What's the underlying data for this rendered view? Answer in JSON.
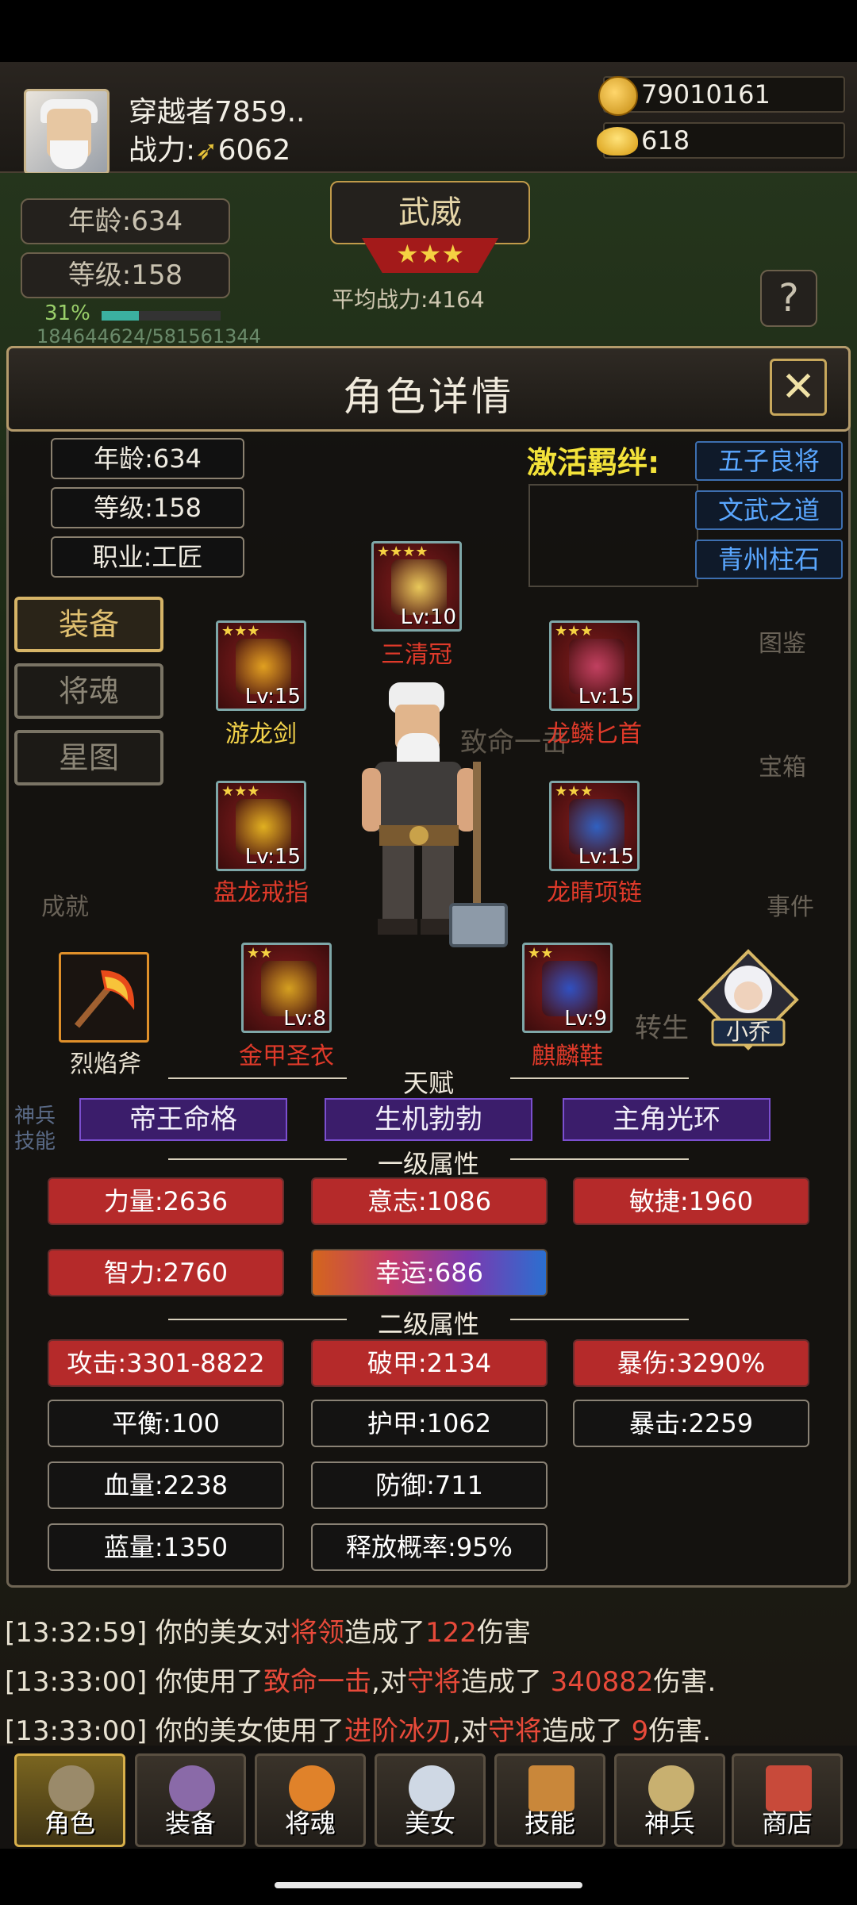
{
  "header": {
    "player_name": "穿越者7859..",
    "power_label": "战力:",
    "power_value": "6062",
    "gold": "79010161",
    "ingot": "618"
  },
  "background": {
    "age": "年龄:634",
    "level": "等级:158",
    "progress_pct": "31%",
    "exp": "184644624/581561344",
    "title_badge": "武威",
    "avg_power": "平均战力:4164",
    "help": "?",
    "side_labels": [
      "图鉴",
      "宝箱",
      "成就",
      "事件",
      "转生"
    ],
    "side_left": [
      "神兵",
      "技能"
    ],
    "center_text": "致命一击"
  },
  "panel": {
    "title": "角色详情",
    "close": "✕",
    "info": {
      "age": "年龄:634",
      "level": "等级:158",
      "job": "职业:工匠"
    },
    "bond_title": "激活羁绊:",
    "bonds": [
      "五子良将",
      "文武之道",
      "青州柱石"
    ],
    "tabs": [
      "装备",
      "将魂",
      "星图"
    ],
    "equipment": [
      {
        "name": "三清冠",
        "lv": "Lv:10",
        "stars": 4,
        "color": "#e8c85a"
      },
      {
        "name": "游龙剑",
        "lv": "Lv:15",
        "stars": 3,
        "color": "#e0a020"
      },
      {
        "name": "龙鳞匕首",
        "lv": "Lv:15",
        "stars": 3,
        "color": "#c04060"
      },
      {
        "name": "盘龙戒指",
        "lv": "Lv:15",
        "stars": 3,
        "color": "#e0b020"
      },
      {
        "name": "龙睛项链",
        "lv": "Lv:15",
        "stars": 3,
        "color": "#3060c0"
      },
      {
        "name": "金甲圣衣",
        "lv": "Lv:8",
        "stars": 2,
        "color": "#d4a020"
      },
      {
        "name": "麒麟鞋",
        "lv": "Lv:9",
        "stars": 2,
        "color": "#3050c0"
      }
    ],
    "weapon_name": "烈焰斧",
    "beauty_name": "小乔",
    "talent_label": "天赋",
    "talents": [
      "帝王命格",
      "生机勃勃",
      "主角光环"
    ],
    "primary_label": "一级属性",
    "primary": [
      "力量:2636",
      "意志:1086",
      "敏捷:1960",
      "智力:2760",
      "幸运:686"
    ],
    "secondary_label": "二级属性",
    "secondary": [
      "攻击:3301-8822",
      "破甲:2134",
      "暴伤:3290%",
      "平衡:100",
      "护甲:1062",
      "暴击:2259",
      "血量:2238",
      "防御:711",
      "蓝量:1350",
      "释放概率:95%"
    ]
  },
  "log": [
    {
      "time": "[13:32:59]",
      "pre": "你的美女对",
      "t1": "将领",
      "mid": "造成了",
      "t2": "122",
      "post": "伤害"
    },
    {
      "time": "[13:33:00]",
      "pre": "你使用了",
      "t1": "致命一击",
      "mid": ",对",
      "t2": "守将",
      "mid2": "造成了 ",
      "t3": "340882",
      "post": "伤害."
    },
    {
      "time": "[13:33:00]",
      "pre": "你的美女使用了",
      "t1": "进阶冰刃",
      "mid": ",对",
      "t2": "守将",
      "mid2": "造成了 ",
      "t3": "9",
      "post": "伤害."
    }
  ],
  "nav": [
    "角色",
    "装备",
    "将魂",
    "美女",
    "技能",
    "神兵",
    "商店"
  ]
}
